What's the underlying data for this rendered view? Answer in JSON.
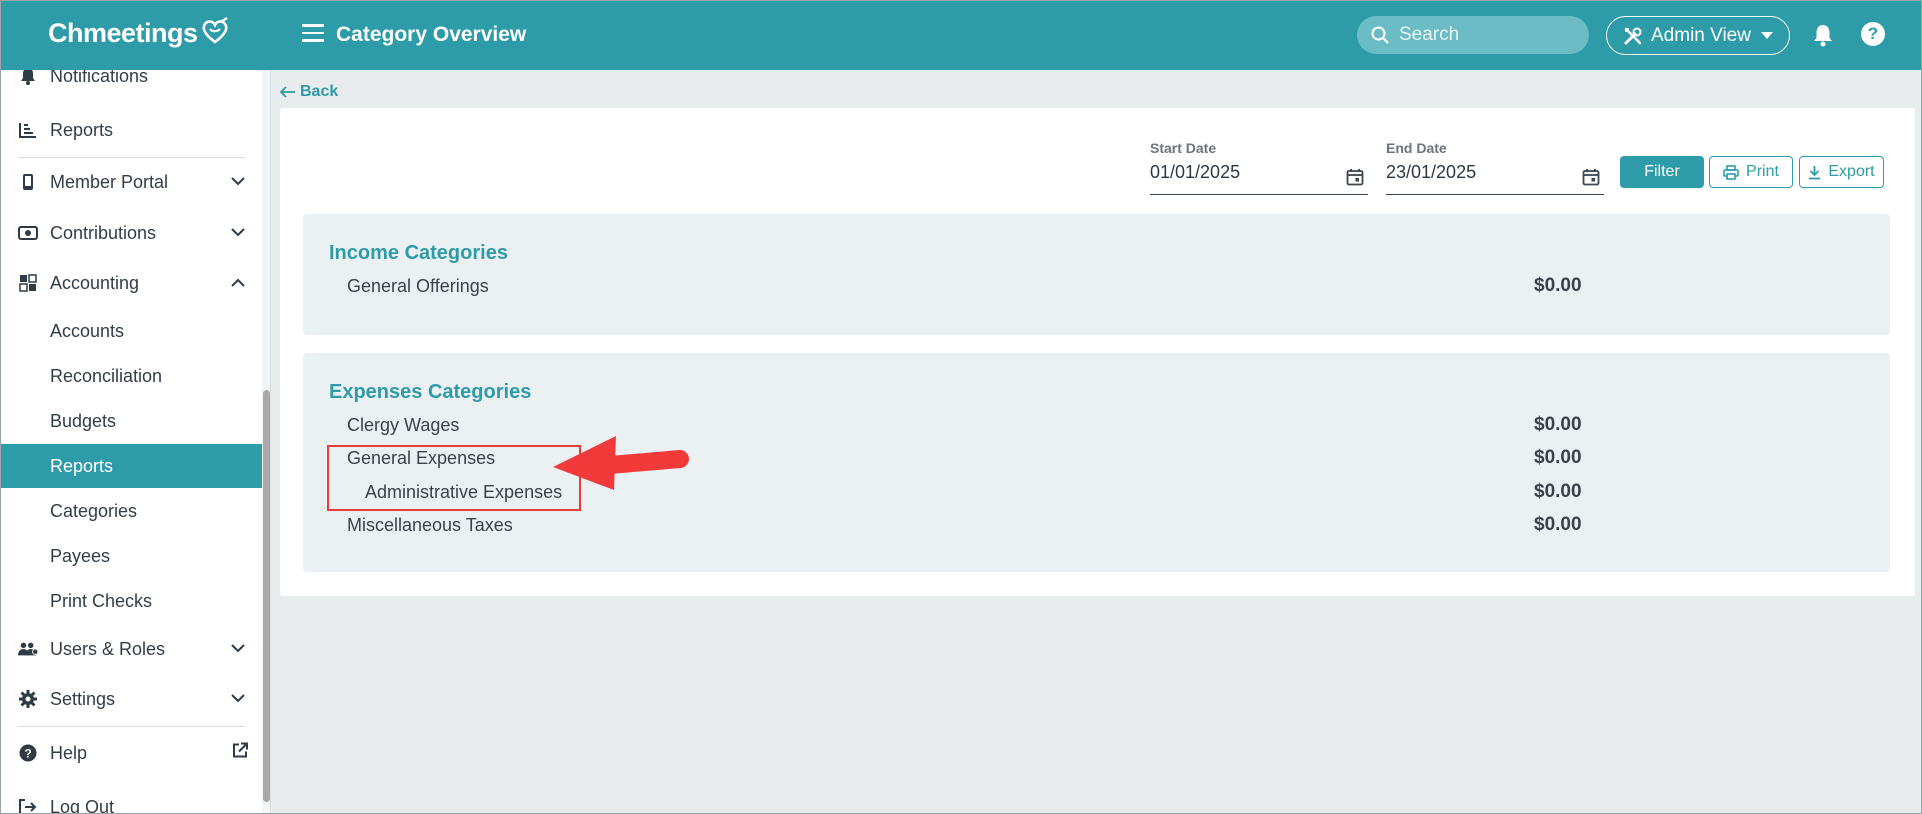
{
  "app": {
    "logo": "Chmeetings",
    "page_title": "Category Overview"
  },
  "topbar": {
    "search_placeholder": "Search",
    "admin_view_label": "Admin View"
  },
  "sidebar": {
    "items": [
      {
        "label": "Notifications"
      },
      {
        "label": "Reports"
      },
      {
        "label": "Member Portal"
      },
      {
        "label": "Contributions"
      },
      {
        "label": "Accounting"
      },
      {
        "label": "Accounts"
      },
      {
        "label": "Reconciliation"
      },
      {
        "label": "Budgets"
      },
      {
        "label": "Reports"
      },
      {
        "label": "Categories"
      },
      {
        "label": "Payees"
      },
      {
        "label": "Print Checks"
      },
      {
        "label": "Users & Roles"
      },
      {
        "label": "Settings"
      },
      {
        "label": "Help"
      },
      {
        "label": "Log Out"
      }
    ]
  },
  "content": {
    "back_label": "Back",
    "start_date": {
      "label": "Start Date",
      "value": "01/01/2025"
    },
    "end_date": {
      "label": "End Date",
      "value": "23/01/2025"
    },
    "buttons": {
      "filter": "Filter",
      "print": "Print",
      "export": "Export"
    },
    "income": {
      "title": "Income Categories",
      "rows": [
        {
          "label": "General Offerings",
          "amount": "$0.00"
        }
      ]
    },
    "expenses": {
      "title": "Expenses Categories",
      "rows": [
        {
          "label": "Clergy Wages",
          "amount": "$0.00"
        },
        {
          "label": "General Expenses",
          "amount": "$0.00"
        },
        {
          "label": "Administrative Expenses",
          "amount": "$0.00"
        },
        {
          "label": "Miscellaneous Taxes",
          "amount": "$0.00"
        }
      ]
    }
  },
  "colors": {
    "primary": "#2e9ba8",
    "annotation": "#e83d3d",
    "background": "#e9eced",
    "section_bg": "#ebf1f3"
  }
}
